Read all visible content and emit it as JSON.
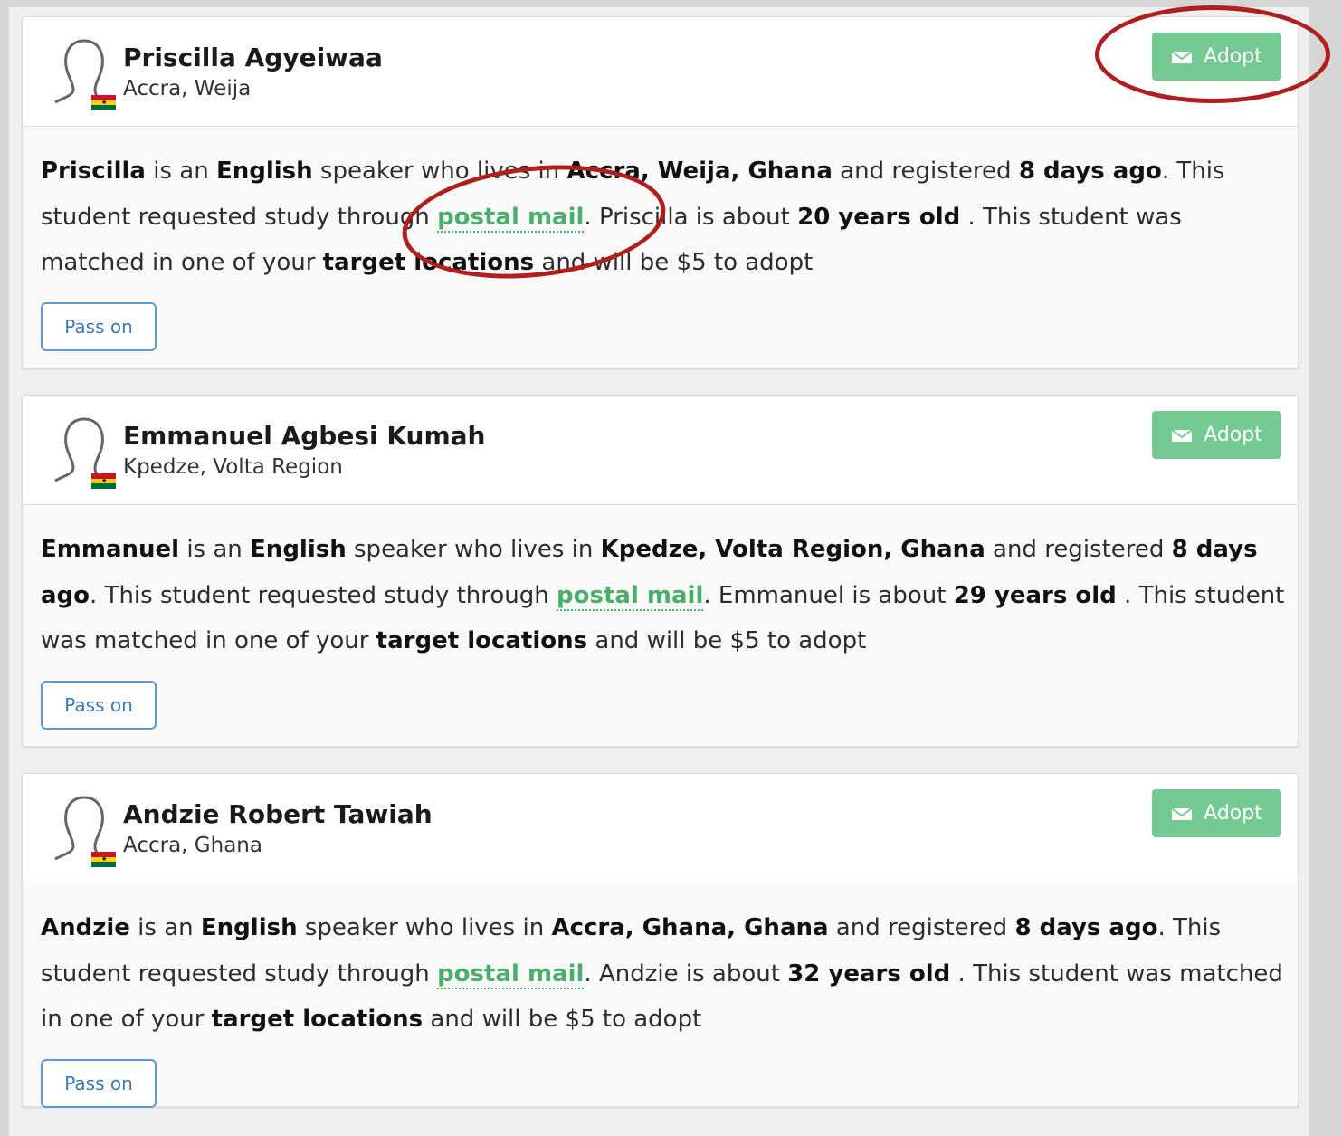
{
  "colors": {
    "adopt_button": "#75c993",
    "postal_mail_link": "#4cae6c",
    "pass_button_border": "#5b9bd5",
    "annotation_ring": "#b01e1e"
  },
  "icons": {
    "avatar": "person-outline-icon",
    "flag": "ghana-flag-icon",
    "adopt": "envelope-icon"
  },
  "students": [
    {
      "name": "Priscilla Agyeiwaa",
      "location": "Accra, Weija",
      "adopt_label": "Adopt",
      "pass_label": "Pass on",
      "desc": {
        "first_name": "Priscilla",
        "t1": " is an ",
        "language": "English",
        "t2": " speaker who lives in ",
        "place": "Accra, Weija, Ghana",
        "t3": " and registered ",
        "registered": "8 days ago",
        "t4": ". This student requested study through ",
        "method": "postal mail",
        "t5": ". Priscilla is about ",
        "age": "20 years old",
        "t6": " . This student was matched in one of your ",
        "target": "target locations",
        "t7": " and will be $5 to adopt"
      }
    },
    {
      "name": "Emmanuel Agbesi Kumah",
      "location": "Kpedze, Volta Region",
      "adopt_label": "Adopt",
      "pass_label": "Pass on",
      "desc": {
        "first_name": "Emmanuel",
        "t1": " is an ",
        "language": "English",
        "t2": " speaker who lives in ",
        "place": "Kpedze, Volta Region, Ghana",
        "t3": " and registered ",
        "registered": "8 days ago",
        "t4": ". This student requested study through ",
        "method": "postal mail",
        "t5": ". Emmanuel is about ",
        "age": "29 years old",
        "t6": " . This student was matched in one of your ",
        "target": "target locations",
        "t7": " and will be $5 to adopt"
      }
    },
    {
      "name": "Andzie Robert Tawiah",
      "location": "Accra, Ghana",
      "adopt_label": "Adopt",
      "pass_label": "Pass on",
      "desc": {
        "first_name": "Andzie",
        "t1": " is an ",
        "language": "English",
        "t2": " speaker who lives in ",
        "place": "Accra, Ghana, Ghana",
        "t3": " and registered ",
        "registered": "8 days ago",
        "t4": ". This student requested study through ",
        "method": "postal mail",
        "t5": ". Andzie is about ",
        "age": "32 years old",
        "t6": " . This student was matched in one of your ",
        "target": "target locations",
        "t7": " and will be $5 to adopt"
      }
    }
  ]
}
